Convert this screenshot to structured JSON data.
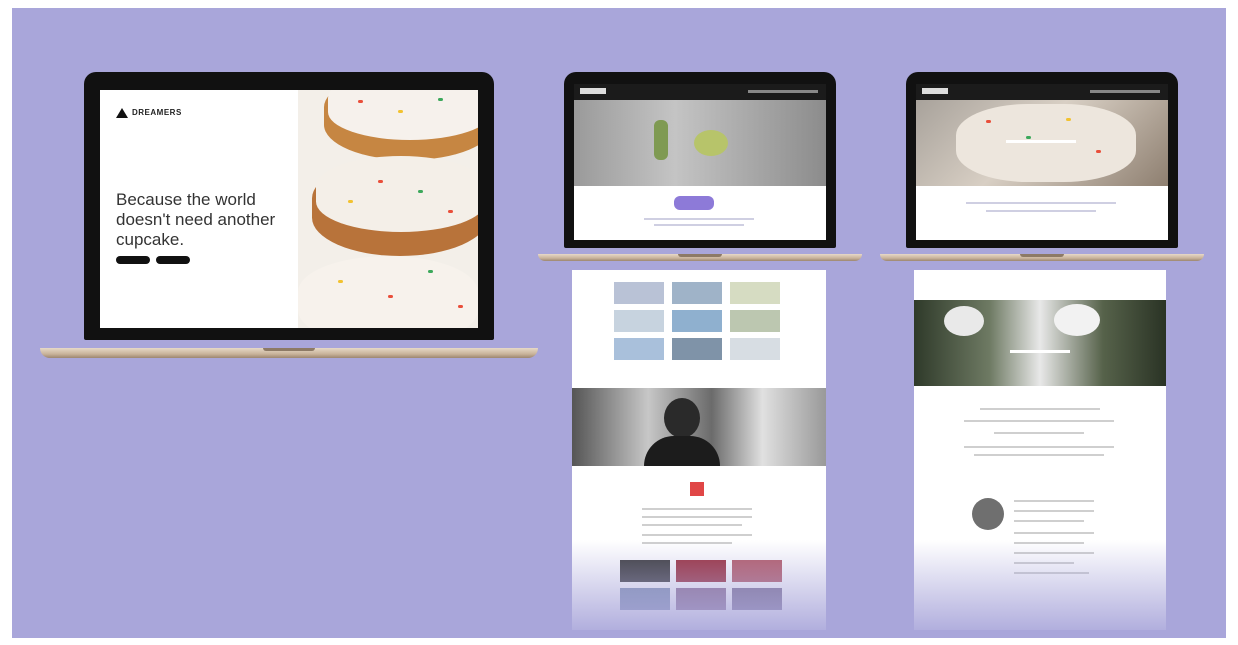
{
  "laptop1": {
    "brand": "DREAMERS",
    "headline": "Because the world doesn't need another cupcake."
  },
  "colors": {
    "background": "#a9a6da",
    "laptop_body": "#111111",
    "laptop_base": "#c9b39a"
  }
}
